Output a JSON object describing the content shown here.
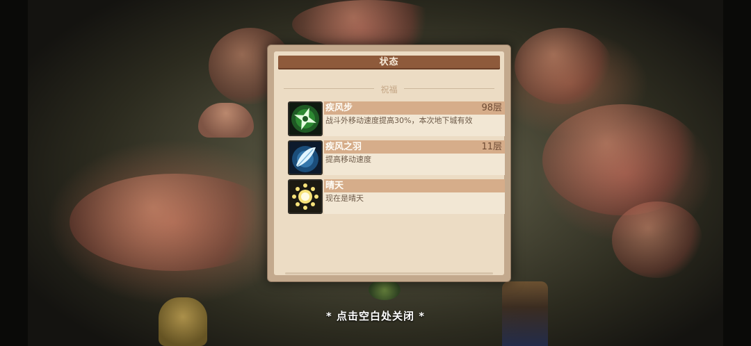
{
  "panel": {
    "title": "状态",
    "section": "祝福"
  },
  "buffs": [
    {
      "name": "疾风步",
      "stack": "98层",
      "desc": "战斗外移动速度提高30%，本次地下城有效",
      "icon": "shuriken-icon"
    },
    {
      "name": "疾风之羽",
      "stack": "11层",
      "desc": "提高移动速度",
      "icon": "feather-icon"
    },
    {
      "name": "晴天",
      "stack": "",
      "desc": "现在是晴天",
      "icon": "sun-icon"
    }
  ],
  "footer": {
    "close_hint": "* 点击空白处关闭 *"
  },
  "colors": {
    "panel_frame": "#c3a98d",
    "panel_paper": "#ecdcc4",
    "title_bar": "#8e5a3b",
    "buff_header": "#d6ad8a"
  }
}
